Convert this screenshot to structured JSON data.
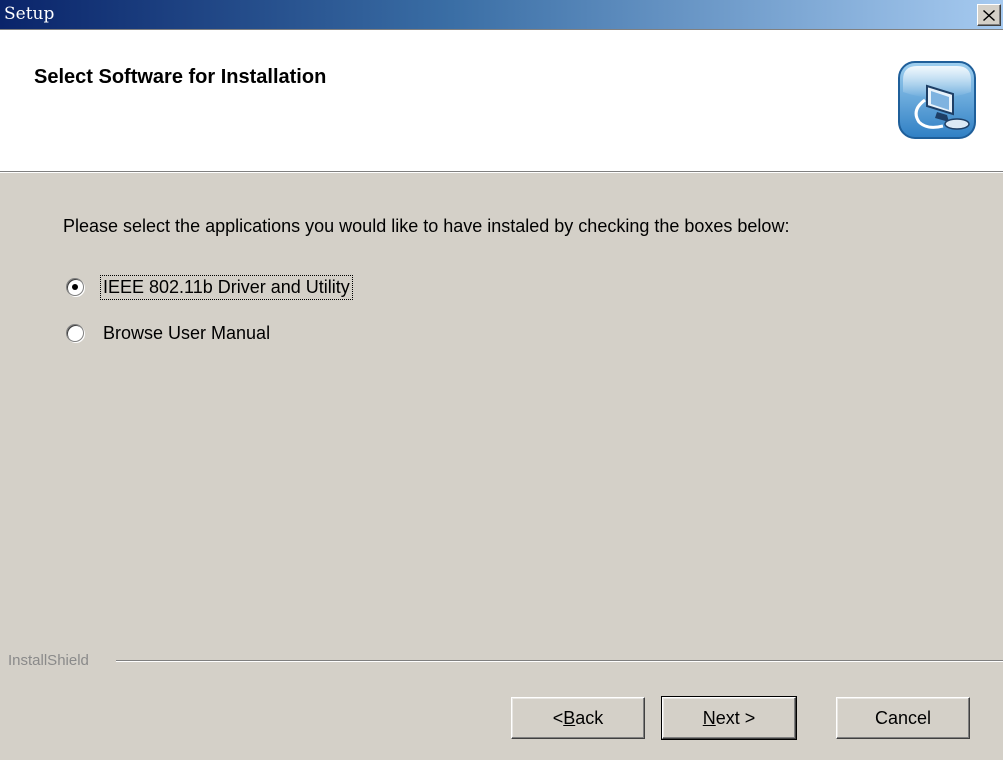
{
  "window": {
    "title": "Setup"
  },
  "header": {
    "heading": "Select Software for Installation",
    "icon": "setup-computer-icon"
  },
  "main": {
    "instructions": "Please select the applications you would like to have instaled by checking the boxes below:",
    "options": [
      {
        "label": "IEEE 802.11b Driver and Utility",
        "selected": true
      },
      {
        "label": "Browse User Manual",
        "selected": false
      }
    ]
  },
  "footer": {
    "brand": "InstallShield",
    "buttons": {
      "back_prefix": "< ",
      "back_mnemonic": "B",
      "back_rest": "ack",
      "next_mnemonic": "N",
      "next_rest": "ext >",
      "cancel": "Cancel"
    }
  },
  "colors": {
    "titlebar_start": "#0a246a",
    "titlebar_end": "#a6caf0",
    "dialog_bg": "#d4d0c8"
  }
}
